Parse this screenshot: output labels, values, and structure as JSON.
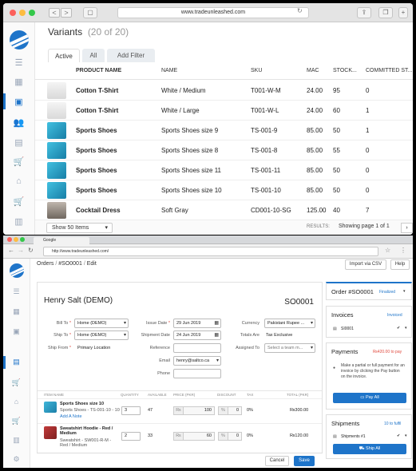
{
  "browser1": {
    "url": "www.tradeunleashed.com",
    "back": "<",
    "fwd": ">"
  },
  "variants": {
    "title": "Variants",
    "count": "(20 of 20)",
    "tabs": [
      "Active",
      "All",
      "Add Filter"
    ],
    "columns": [
      "PRODUCT NAME",
      "NAME",
      "SKU",
      "MAC",
      "STOCK...",
      "COMMITTED ST..."
    ],
    "rows": [
      {
        "product": "Cotton T-Shirt",
        "name": "White / Medium",
        "sku": "T001-W-M",
        "mac": "24.00",
        "stock": "95",
        "committed": "0",
        "thumb": "tshirt"
      },
      {
        "product": "Cotton T-Shirt",
        "name": "White / Large",
        "sku": "T001-W-L",
        "mac": "24.00",
        "stock": "60",
        "committed": "1",
        "thumb": "tshirt"
      },
      {
        "product": "Sports Shoes",
        "name": "Sports Shoes size 9",
        "sku": "TS-001-9",
        "mac": "85.00",
        "stock": "50",
        "committed": "1",
        "thumb": "shoe"
      },
      {
        "product": "Sports Shoes",
        "name": "Sports Shoes size 8",
        "sku": "TS-001-8",
        "mac": "85.00",
        "stock": "55",
        "committed": "0",
        "thumb": "shoe"
      },
      {
        "product": "Sports Shoes",
        "name": "Sports Shoes size 11",
        "sku": "TS-001-11",
        "mac": "85.00",
        "stock": "50",
        "committed": "0",
        "thumb": "shoe"
      },
      {
        "product": "Sports Shoes",
        "name": "Sports Shoes size 10",
        "sku": "TS-001-10",
        "mac": "85.00",
        "stock": "50",
        "committed": "0",
        "thumb": "shoe"
      },
      {
        "product": "Cocktail Dress",
        "name": "Soft Gray",
        "sku": "CD001-10-SG",
        "mac": "125.00",
        "stock": "40",
        "committed": "7",
        "thumb": "dress"
      }
    ],
    "footer": {
      "show": "Show 50 Items",
      "results": "RESULTS:",
      "page": "Showing page 1 of 1"
    }
  },
  "browser2": {
    "tab": "Google",
    "url": "http://www.tradeunleashed.com/"
  },
  "order": {
    "crumb_orders": "Orders",
    "crumb_sep": "/",
    "crumb_id": "#SO0001",
    "crumb_edit": "Edit",
    "import_label": "Import via CSV",
    "help_label": "Help",
    "customer": "Henry Salt (DEMO)",
    "so_number": "SO0001",
    "fields": {
      "bill_to_label": "Bill To",
      "bill_to": "Home (DEMO)",
      "ship_to_label": "Ship To",
      "ship_to": "Home (DEMO)",
      "ship_from_label": "Ship From",
      "ship_from": "Primary Location",
      "issue_date_label": "Issue Date",
      "issue_date": "29 Jun 2019",
      "shipment_date_label": "Shipment Date",
      "shipment_date": "24 Jun 2019",
      "reference_label": "Reference",
      "email_label": "Email",
      "email": "henry@saltco.ca",
      "phone_label": "Phone",
      "currency_label": "Currency",
      "currency": "Pakistani Rupee ...",
      "totals_label": "Totals Are",
      "totals": "Tax Exclusive",
      "assigned_label": "Assigned To",
      "assigned": "Select a team m..."
    },
    "item_cols": [
      "ITEM NAME",
      "QUANTITY",
      "AVAILABLE",
      "PRICE (PKR)",
      "DISCOUNT",
      "TAX",
      "TOTAL (PKR)"
    ],
    "items": [
      {
        "name": "Sports Shoes size 10",
        "sub": "Sports Shoes - TS-001-10 - 10",
        "note": "Add A Note",
        "qty": "3",
        "avail": "47",
        "price": "100",
        "disc": "0",
        "tax": "0%",
        "total": "₨300.00"
      },
      {
        "name": "Sweatshirt Hoodie - Red / Medium",
        "sub": "Sweatshirt - SW001-R-M - Red / Medium",
        "qty": "2",
        "avail": "33",
        "price": "60",
        "disc": "0",
        "tax": "0%",
        "total": "₨120.00"
      }
    ],
    "price_prefix": "₨",
    "disc_prefix": "%",
    "cancel_label": "Cancel",
    "save_label": "Save"
  },
  "right": {
    "order_title": "Order #SO0001",
    "order_status": "Finalized",
    "invoices_title": "Invoices",
    "invoices_status": "Invoiced",
    "invoice_id": "SI0001",
    "payments_title": "Payments",
    "payments_due": "₨420.00 to pay",
    "payments_note": "Make a partial or full payment for an invoice by clicking the Pay button on the invoice.",
    "pay_all": "Pay All",
    "shipments_title": "Shipments",
    "shipments_status": "10 to fulfil",
    "shipment_id": "Shipments #1",
    "ship_all": "Ship All"
  },
  "colors": {
    "accent": "#1e74c9",
    "status": "#1e74c9",
    "due": "#e0493e"
  }
}
